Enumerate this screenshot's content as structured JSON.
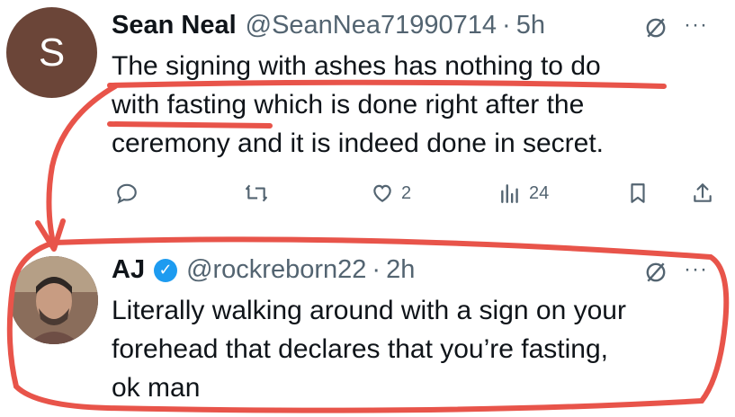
{
  "tweets": [
    {
      "avatar_letter": "S",
      "name": "Sean Neal",
      "handle": "@SeanNea71990714",
      "separator": "·",
      "time": "5h",
      "more": "···",
      "lines": [
        "The signing with ashes has nothing to do",
        "with fasting which is done right after the",
        "ceremony and it is indeed done in secret."
      ],
      "actions": {
        "reply_count": "",
        "retweet_count": "",
        "like_count": "2",
        "view_count": "24"
      }
    },
    {
      "name": "AJ",
      "verified": true,
      "handle": "@rockreborn22",
      "separator": "·",
      "time": "2h",
      "more": "···",
      "lines": [
        "Literally walking around with a sign on your",
        "forehead that declares that you’re fasting,",
        "ok man"
      ]
    }
  ],
  "colors": {
    "annotation_red": "#e8544a",
    "secondary_text": "#536471",
    "verified_blue": "#1d9bf0",
    "avatar_brown": "#6b4538"
  },
  "icons": [
    "grok-icon",
    "more-icon",
    "reply-icon",
    "retweet-icon",
    "like-icon",
    "views-icon",
    "bookmark-icon",
    "share-icon",
    "verified-badge-icon"
  ]
}
